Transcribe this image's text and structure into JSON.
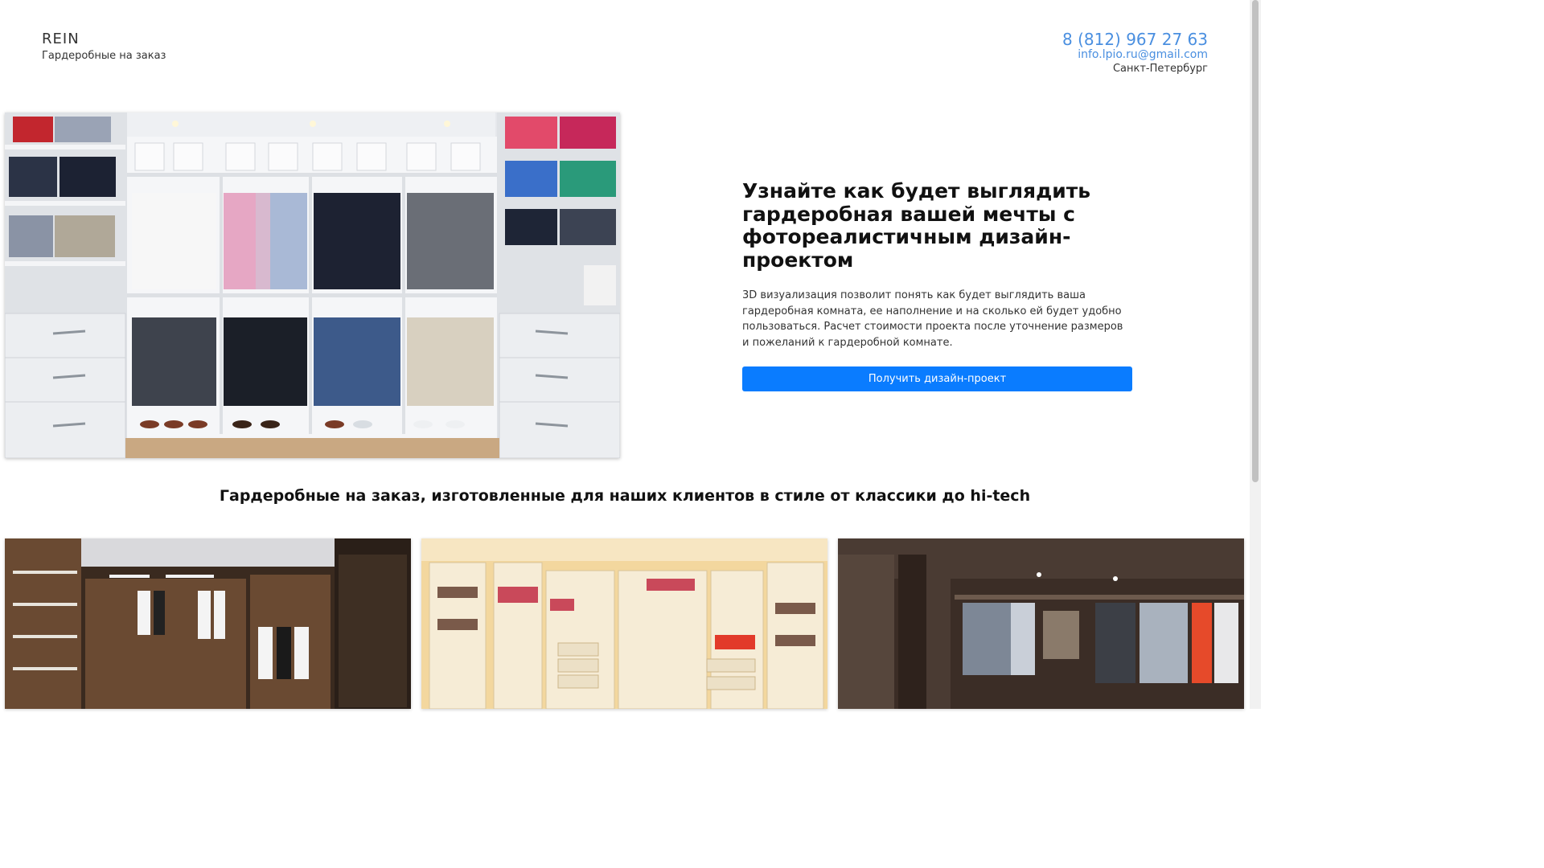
{
  "header": {
    "brand_name": "REIN",
    "brand_tagline": "Гардеробные на заказ",
    "phone": "8 (812) 967 27 63",
    "email": "info.lpio.ru@gmail.com",
    "city": "Санкт-Петербург"
  },
  "hero": {
    "title": "Узнайте как будет выглядить гардеробная вашей мечты с фотореалистичным дизайн-проектом",
    "description": "3D визуализация позволит понять как будет выглядить ваша гардеробная комната, ее наполнение и на сколько ей будет удобно пользоваться. Расчет стоимости проекта после уточнение размеров и пожеланий к гардеробной комнате.",
    "cta_label": "Получить дизайн-проект"
  },
  "gallery": {
    "title": "Гардеробные на заказ, изготовленные для наших клиентов в стиле от классики до hi-tech"
  },
  "colors": {
    "accent": "#0a7cff",
    "link": "#4a8fe0"
  }
}
